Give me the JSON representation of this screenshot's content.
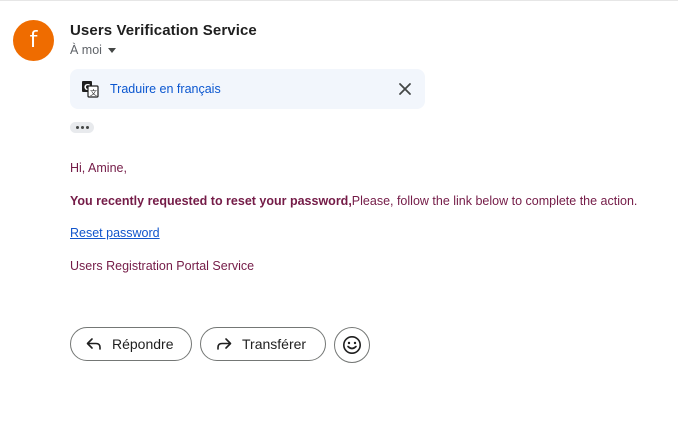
{
  "email": {
    "avatar_letter": "f",
    "avatar_color": "#ef6c00",
    "sender_name": "Users Verification Service",
    "recipient_label": "À moi",
    "translate_label": "Traduire en français",
    "greeting": "Hi, Amine,",
    "message_bold": "You recently requested to reset your password,",
    "message_rest": "Please, follow the link below to complete the action.",
    "reset_link_text": "Reset password",
    "signature": "Users Registration Portal Service",
    "body_text_color": "#741b47",
    "link_color": "#1155cc"
  },
  "actions": {
    "reply_label": "Répondre",
    "forward_label": "Transférer"
  },
  "icons": {
    "translate": "translate-icon",
    "close": "close-icon",
    "reply": "reply-arrow-icon",
    "forward": "forward-arrow-icon",
    "emoji": "smiley-icon",
    "ellipsis": "more-dots-icon",
    "caret": "caret-down-icon"
  }
}
